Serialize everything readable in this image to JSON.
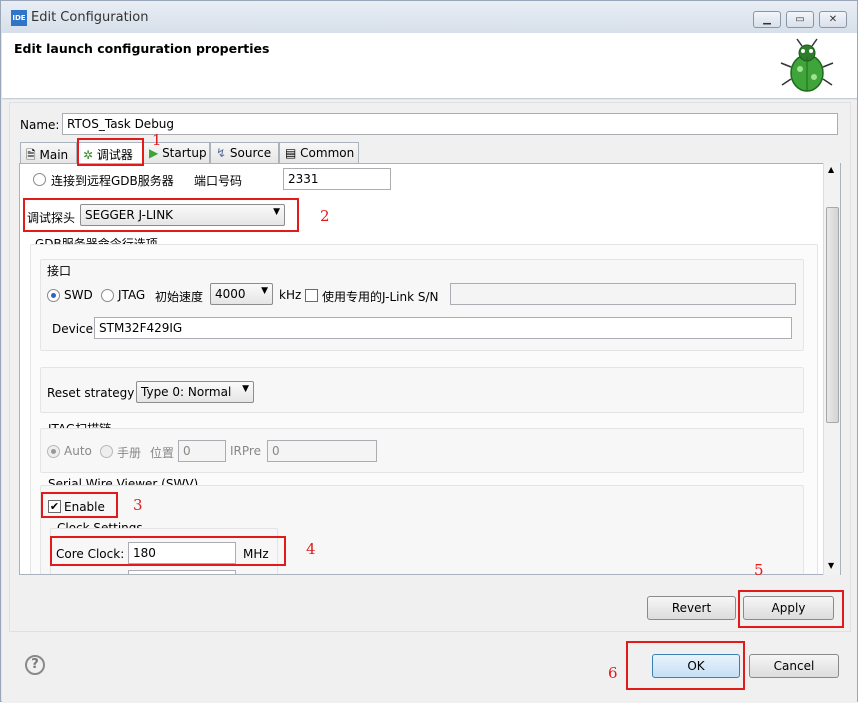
{
  "window": {
    "title": "Edit Configuration",
    "logo": "IDE"
  },
  "header": {
    "title": "Edit launch configuration properties",
    "icon": "bug-icon"
  },
  "name": {
    "label": "Name:",
    "value": "RTOS_Task Debug"
  },
  "tabs": [
    {
      "label": "Main",
      "icon": "page-icon"
    },
    {
      "label": "调试器",
      "icon": "debugger-bug-icon"
    },
    {
      "label": "Startup",
      "icon": "play-icon"
    },
    {
      "label": "Source",
      "icon": "source-icon"
    },
    {
      "label": "Common",
      "icon": "common-icon"
    }
  ],
  "debugger": {
    "remote_gdb_label": "连接到远程GDB服务器",
    "port_label": "端口号码",
    "port_value": "2331",
    "probe_label": "调试探头",
    "probe_value": "SEGGER J-LINK",
    "gdb_options_title": "GDB服务器命令行选项",
    "interface_title": "接口",
    "swd_label": "SWD",
    "jtag_label": "JTAG",
    "speed_label": "初始速度",
    "speed_value": "4000",
    "speed_unit": "kHz",
    "dedicated_jlink_label": "使用专用的J-Link S/N",
    "device_label": "Device",
    "device_value": "STM32F429IG",
    "reset_label": "Reset strategy",
    "reset_value": "Type 0: Normal",
    "jtag_chain_title": "JTAG扫描链",
    "auto_label": "Auto",
    "manual_label": "手册",
    "position_label": "位置",
    "position_value": "0",
    "irpre_label": "IRPre",
    "irpre_value": "0",
    "swv_title": "Serial Wire Viewer (SWV)",
    "enable_label": "Enable",
    "enable_checked": "✔",
    "clock_title": "Clock Settings",
    "core_clock_label": "Core Clock:",
    "core_clock_value": "180",
    "core_clock_unit": "MHz"
  },
  "buttons": {
    "revert": "Revert",
    "apply": "Apply",
    "ok": "OK",
    "cancel": "Cancel",
    "help": "?"
  },
  "annotations": [
    "1",
    "2",
    "3",
    "4",
    "5",
    "6"
  ],
  "colors": {
    "annotation": "#e21a1a",
    "selection": "#2a64c5"
  }
}
